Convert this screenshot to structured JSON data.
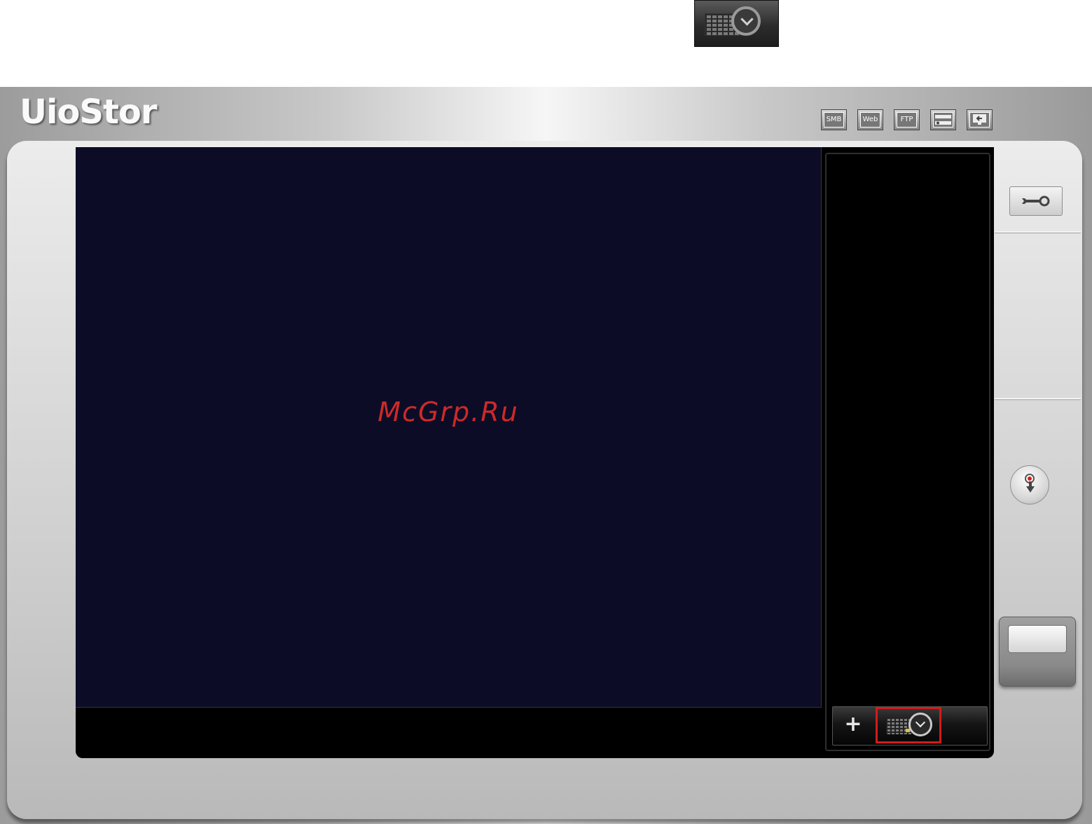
{
  "app": {
    "brand": "UioStor"
  },
  "top_icons": [
    {
      "name": "smb-icon",
      "label": "SMB"
    },
    {
      "name": "web-icon",
      "label": "Web"
    },
    {
      "name": "ftp-icon",
      "label": "FTP"
    }
  ],
  "watermark": "McGrp.Ru",
  "side_panel": {
    "add_symbol": "+"
  },
  "colors": {
    "video_bg": "#0c0c26",
    "highlight": "#d21b1b"
  }
}
